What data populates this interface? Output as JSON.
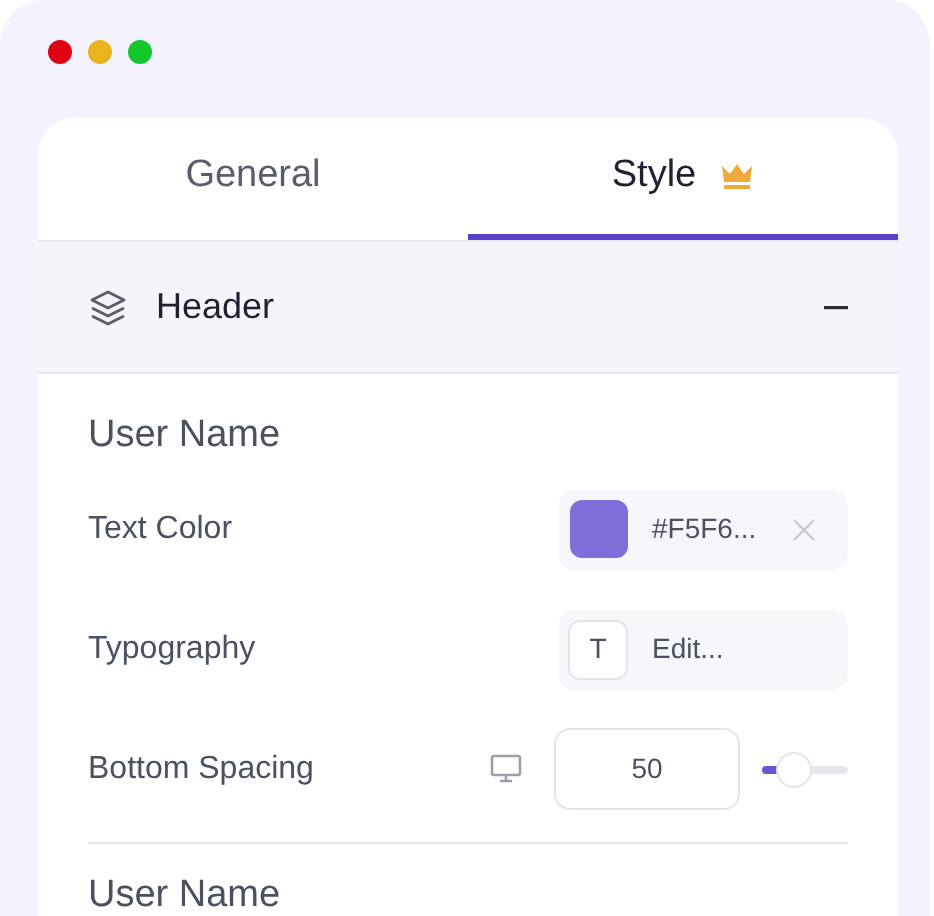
{
  "tabs": [
    {
      "label": "General",
      "selected": false,
      "premium": false
    },
    {
      "label": "Style",
      "selected": true,
      "premium": true
    }
  ],
  "section": {
    "title": "Header",
    "expanded": true
  },
  "groups": [
    {
      "title": "User Name",
      "rows": [
        {
          "kind": "color",
          "label": "Text Color",
          "color": "#806fdb",
          "value": "#F5F6..."
        },
        {
          "kind": "typography",
          "label": "Typography",
          "glyph": "T",
          "value": "Edit..."
        },
        {
          "kind": "range",
          "label": "Bottom Spacing",
          "value": "50",
          "level": 0.33
        }
      ]
    },
    {
      "title": "User Name"
    }
  ]
}
